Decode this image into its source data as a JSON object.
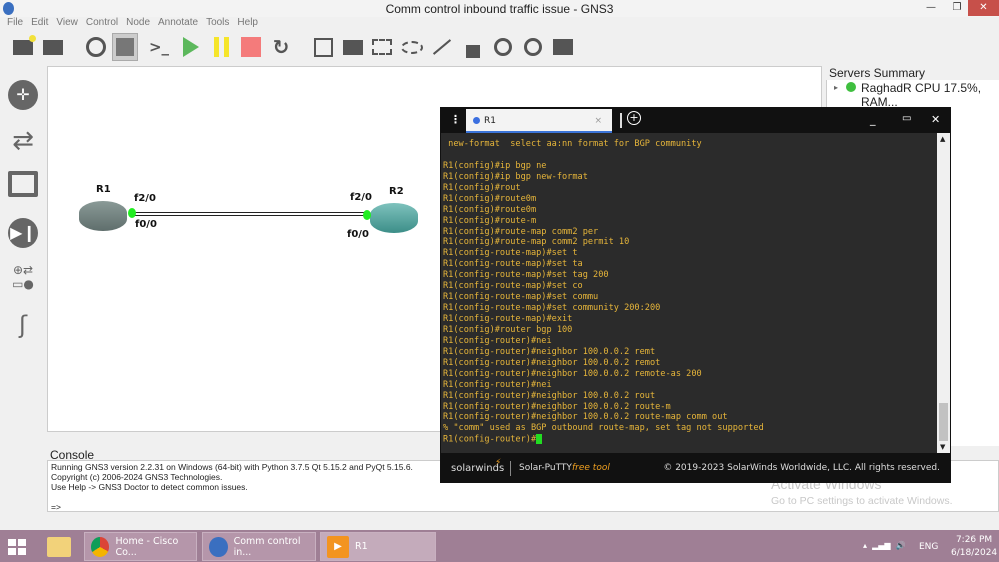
{
  "window": {
    "title": "Comm control inbound traffic issue - GNS3"
  },
  "menu": [
    "File",
    "Edit",
    "View",
    "Control",
    "Node",
    "Annotate",
    "Tools",
    "Help"
  ],
  "toolbar": [
    "new-project-icon",
    "open-project-icon",
    "snapshot-clock-icon",
    "show-interface-labels-icon",
    "console-all-icon",
    "start-all-icon",
    "suspend-all-icon",
    "stop-all-icon",
    "reload-all-icon",
    "add-note-icon",
    "insert-image-icon",
    "draw-rectangle-icon",
    "draw-ellipse-icon",
    "draw-line-icon",
    "lock-icon",
    "zoom-in-icon",
    "zoom-out-icon",
    "screenshot-icon"
  ],
  "colors": {
    "start": "#5cb85c",
    "suspend": "#f5e52a",
    "stop": "#f47b7b",
    "terminal_text": "#e6b53a",
    "cursor": "#22dd22",
    "link_up": "#22ee22"
  },
  "topology": {
    "r1": {
      "name": "R1",
      "port_a": "f2/0",
      "port_b": "f0/0"
    },
    "r2": {
      "name": "R2",
      "port_a": "f2/0",
      "port_b": "f0/0"
    }
  },
  "servers": {
    "title": "Servers Summary",
    "item": "RaghadR CPU 17.5%, RAM..."
  },
  "console": {
    "title": "Console",
    "lines": [
      "Running GNS3 version 2.2.31 on Windows (64-bit) with Python 3.7.5 Qt 5.15.2 and PyQt 5.15.6.",
      "Copyright (c) 2006-2024 GNS3 Technologies.",
      "Use Help -> GNS3 Doctor to detect common issues.",
      "",
      "=>"
    ]
  },
  "putty": {
    "tab": "R1",
    "brand": "solarwinds",
    "product": "Solar-PuTTY",
    "free": "free tool",
    "copyright": "© 2019-2023 SolarWinds Worldwide, LLC. All rights reserved.",
    "lines": [
      " new-format  select aa:nn format for BGP community",
      "",
      "R1(config)#ip bgp ne",
      "R1(config)#ip bgp new-format",
      "R1(config)#rout",
      "R1(config)#route0m",
      "R1(config)#route0m",
      "R1(config)#route-m",
      "R1(config)#route-map comm2 per",
      "R1(config)#route-map comm2 permit 10",
      "R1(config-route-map)#set t",
      "R1(config-route-map)#set ta",
      "R1(config-route-map)#set tag 200",
      "R1(config-route-map)#set co",
      "R1(config-route-map)#set commu",
      "R1(config-route-map)#set community 200:200",
      "R1(config-route-map)#exit",
      "R1(config)#router bgp 100",
      "R1(config-router)#nei",
      "R1(config-router)#neighbor 100.0.0.2 remt",
      "R1(config-router)#neighbor 100.0.0.2 remot",
      "R1(config-router)#neighbor 100.0.0.2 remote-as 200",
      "R1(config-router)#nei",
      "R1(config-router)#neighbor 100.0.0.2 rout",
      "R1(config-router)#neighbor 100.0.0.2 route-m",
      "R1(config-router)#neighbor 100.0.0.2 route-map comm out",
      "% \"comm\" used as BGP outbound route-map, set tag not supported"
    ],
    "prompt": "R1(config-router)#"
  },
  "watermark": {
    "line1": "Activate Windows",
    "line2": "Go to PC settings to activate Windows."
  },
  "taskbar": {
    "tasks": [
      "Home - Cisco Co...",
      "Comm control in...",
      "R1"
    ],
    "lang": "ENG",
    "time": "7:26 PM",
    "date": "6/18/2024"
  }
}
